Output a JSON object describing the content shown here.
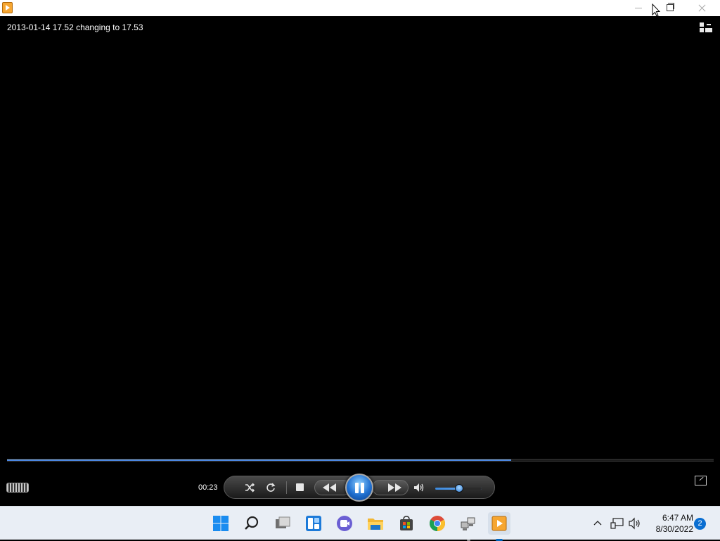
{
  "window": {
    "app_icon": "media-player-icon",
    "controls": [
      "minimize-icon",
      "restore-icon",
      "close-icon"
    ]
  },
  "media": {
    "title": "2013-01-14 17.52 changing to 17.53",
    "elapsed": "00:23",
    "progress_fraction": 0.713,
    "volume_fraction": 0.52,
    "state": "playing"
  },
  "player_controls": {
    "icons": [
      "shuffle-icon",
      "repeat-icon",
      "stop-icon",
      "previous-icon",
      "pause-icon",
      "next-icon",
      "mute-icon"
    ]
  },
  "taskbar": {
    "apps": [
      {
        "name": "start",
        "icon": "windows-start-icon"
      },
      {
        "name": "search",
        "icon": "search-icon"
      },
      {
        "name": "task-view",
        "icon": "task-view-icon"
      },
      {
        "name": "widgets",
        "icon": "widgets-icon"
      },
      {
        "name": "chat",
        "icon": "teams-chat-icon"
      },
      {
        "name": "file-explorer",
        "icon": "folder-icon"
      },
      {
        "name": "store",
        "icon": "store-icon"
      },
      {
        "name": "chrome",
        "icon": "chrome-icon"
      },
      {
        "name": "network-app",
        "icon": "network-computers-icon"
      },
      {
        "name": "media-player",
        "icon": "media-player-icon"
      }
    ],
    "clock": {
      "time": "6:47 AM",
      "date": "8/30/2022"
    },
    "notification_count": "2"
  },
  "colors": {
    "accent": "#0067c0",
    "seek_fill": "#2f6fd6",
    "taskbar_bg": "#e9eef5"
  }
}
